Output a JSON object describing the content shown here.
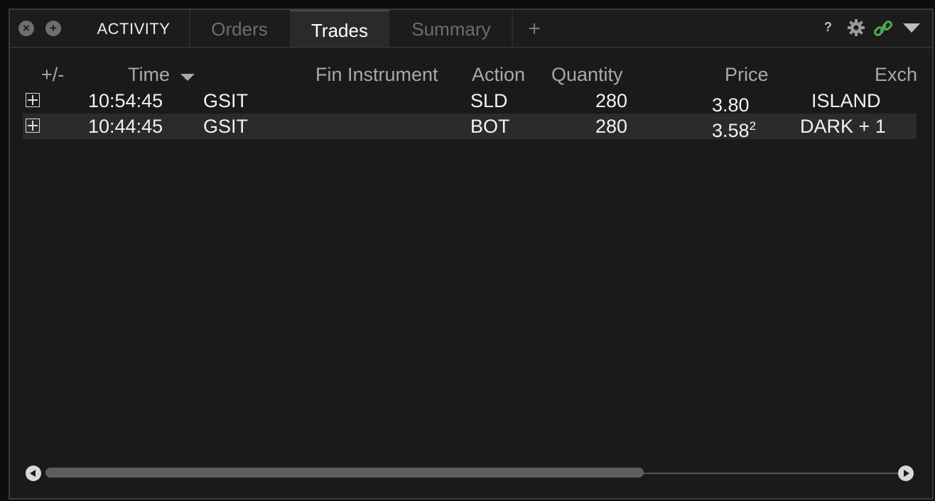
{
  "window": {
    "tabs": {
      "activity": "ACTIVITY",
      "orders": "Orders",
      "trades": "Trades",
      "summary": "Summary",
      "add": "+"
    },
    "toolbar": {
      "help": "?"
    }
  },
  "table": {
    "columns": {
      "expand": "+/-",
      "time": "Time",
      "fin_instrument": "Fin Instrument",
      "action": "Action",
      "quantity": "Quantity",
      "price": "Price",
      "exch": "Exch"
    },
    "rows": [
      {
        "time": "10:54:45",
        "symbol": "GSIT",
        "action": "SLD",
        "quantity": "280",
        "price": "3.80",
        "price_sup": "",
        "exch": "ISLAND"
      },
      {
        "time": "10:44:45",
        "symbol": "GSIT",
        "action": "BOT",
        "quantity": "280",
        "price": "3.58",
        "price_sup": "2",
        "exch": "DARK + 1"
      }
    ]
  },
  "colors": {
    "background": "#1a1a1a",
    "link_icon": "#4caf50",
    "text": "#f2f2f2"
  }
}
